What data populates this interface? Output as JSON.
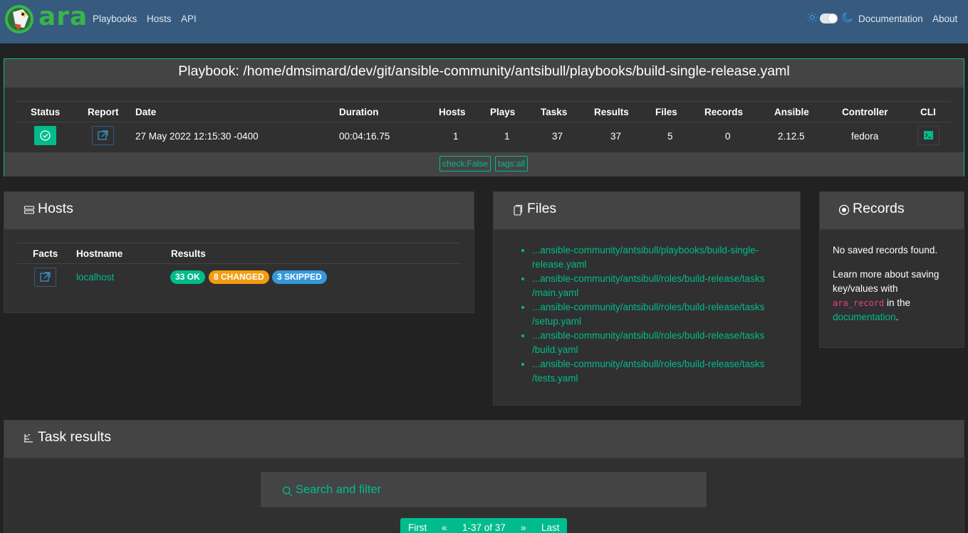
{
  "navbar": {
    "brand": "ara",
    "links": [
      "Playbooks",
      "Hosts",
      "API"
    ],
    "right_links": [
      "Documentation",
      "About"
    ],
    "colors": {
      "background": "#375a7f",
      "accent": "#00bc8c"
    }
  },
  "playbook": {
    "title": "Playbook: /home/dmsimard/dev/git/ansible-community/antsibull/playbooks/build-single-release.yaml",
    "headers": [
      "Status",
      "Report",
      "Date",
      "Duration",
      "Hosts",
      "Plays",
      "Tasks",
      "Results",
      "Files",
      "Records",
      "Ansible",
      "Controller",
      "CLI"
    ],
    "row": {
      "date": "27 May 2022 12:15:30 -0400",
      "duration": "00:04:16.75",
      "hosts": "1",
      "plays": "1",
      "tasks": "37",
      "results": "37",
      "files": "5",
      "records": "0",
      "ansible": "2.12.5",
      "controller": "fedora"
    },
    "tags": [
      "check:False",
      "tags:all"
    ]
  },
  "hosts_card": {
    "title": "Hosts",
    "headers": [
      "Facts",
      "Hostname",
      "Results"
    ],
    "row": {
      "hostname": "localhost",
      "badges": [
        {
          "label": "33 OK",
          "color": "#00bc8c"
        },
        {
          "label": "8 CHANGED",
          "color": "#f39c12"
        },
        {
          "label": "3 SKIPPED",
          "color": "#3498db"
        }
      ]
    }
  },
  "files_card": {
    "title": "Files",
    "files": [
      {
        "line1": "...ansible-community/antsibull/playbooks/build-single-",
        "line2": "release.yaml"
      },
      {
        "line1": "...ansible-community/antsibull/roles/build-release/tasks",
        "line2": "/main.yaml"
      },
      {
        "line1": "...ansible-community/antsibull/roles/build-release/tasks",
        "line2": "/setup.yaml"
      },
      {
        "line1": "...ansible-community/antsibull/roles/build-release/tasks",
        "line2": "/build.yaml"
      },
      {
        "line1": "...ansible-community/antsibull/roles/build-release/tasks",
        "line2": "/tests.yaml"
      }
    ]
  },
  "records_card": {
    "title": "Records",
    "empty_text": "No saved records found.",
    "learn_prefix": "Learn more about saving key/values with",
    "code": "ara_record",
    "learn_mid": "in the",
    "link": "documentation",
    "learn_suffix": "."
  },
  "tasks_card": {
    "title": "Task results",
    "search_placeholder": "Search and filter",
    "pager": {
      "first": "First",
      "prev": "«",
      "range": "1-37 of 37",
      "next": "»",
      "last": "Last"
    }
  }
}
